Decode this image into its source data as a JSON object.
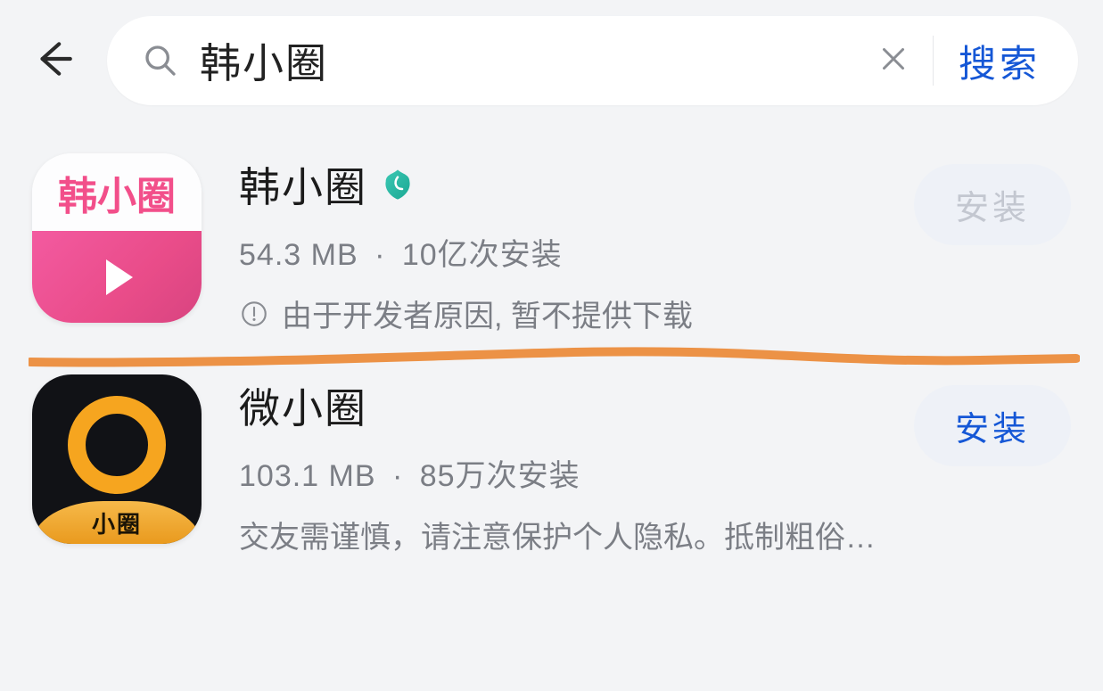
{
  "search": {
    "query": "韩小圈",
    "button_label": "搜索"
  },
  "apps": [
    {
      "name": "韩小圈",
      "icon_text_top": "韩小圈",
      "size": "54.3 MB",
      "installs": "10亿次安装",
      "note": "由于开发者原因, 暂不提供下载",
      "install_label": "安装",
      "install_enabled": false,
      "verified": true,
      "annotated": true
    },
    {
      "name": "微小圈",
      "icon_band_text": "小圈",
      "size": "103.1 MB",
      "installs": "85万次安装",
      "note": "交友需谨慎，请注意保护个人隐私。抵制粗俗…",
      "install_label": "安装",
      "install_enabled": true,
      "verified": false,
      "annotated": false
    }
  ]
}
